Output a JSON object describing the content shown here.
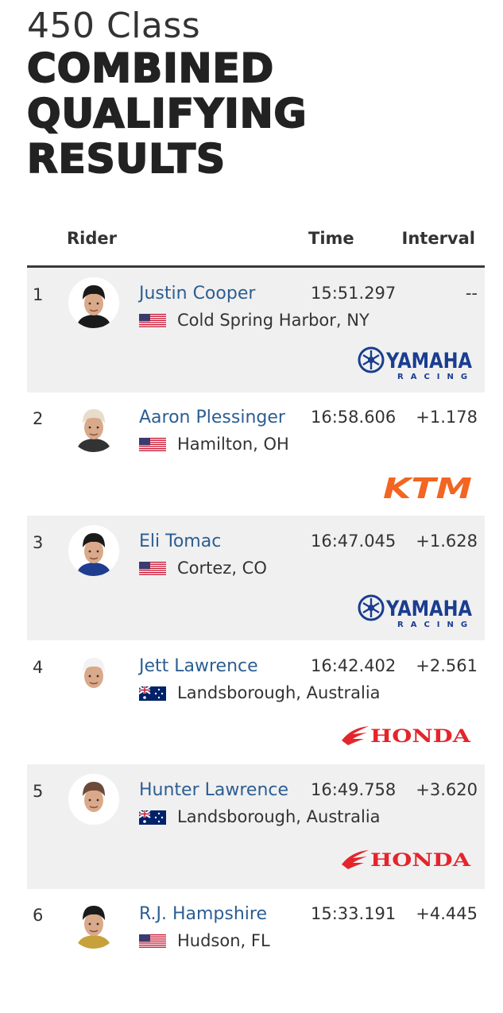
{
  "heading": {
    "class_label": "450 Class",
    "title_lines": [
      "COMBINED",
      "QUALIFYING",
      "RESULTS"
    ]
  },
  "table": {
    "columns": {
      "rider": "Rider",
      "time": "Time",
      "interval": "Interval"
    },
    "rows": [
      {
        "pos": "1",
        "name": "Justin Cooper",
        "location": "Cold Spring Harbor, NY",
        "flag": "usa-flag",
        "time": "15:51.297",
        "interval": "--",
        "brand": "yamaha",
        "helmet": "#1a1a1a",
        "shirt": "#1a1a1a"
      },
      {
        "pos": "2",
        "name": "Aaron Plessinger",
        "location": "Hamilton, OH",
        "flag": "usa-flag",
        "time": "16:58.606",
        "interval": "+1.178",
        "brand": "ktm",
        "helmet": "#e8dccb",
        "shirt": "#333333"
      },
      {
        "pos": "3",
        "name": "Eli Tomac",
        "location": "Cortez, CO",
        "flag": "usa-flag",
        "time": "16:47.045",
        "interval": "+1.628",
        "brand": "yamaha",
        "helmet": "#1a1a1a",
        "shirt": "#1f3d8f"
      },
      {
        "pos": "4",
        "name": "Jett Lawrence",
        "location": "Landsborough, Australia",
        "flag": "australia-flag",
        "time": "16:42.402",
        "interval": "+2.561",
        "brand": "honda",
        "helmet": "#f2f2f2",
        "shirt": "#ffffff"
      },
      {
        "pos": "5",
        "name": "Hunter Lawrence",
        "location": "Landsborough, Australia",
        "flag": "australia-flag",
        "time": "16:49.758",
        "interval": "+3.620",
        "brand": "honda",
        "helmet": "#6b4a3a",
        "shirt": "#ffffff"
      },
      {
        "pos": "6",
        "name": "R.J. Hampshire",
        "location": "Hudson, FL",
        "flag": "usa-flag",
        "time": "15:33.191",
        "interval": "+4.445",
        "brand": "",
        "helmet": "#1a1a1a",
        "shirt": "#c7a23a"
      }
    ]
  },
  "brands": {
    "yamaha": {
      "name": "YAMAHA",
      "sub": "RACING",
      "color": "#1a3d8f"
    },
    "ktm": {
      "name": "KTM",
      "color": "#f26522"
    },
    "honda": {
      "name": "HONDA",
      "color": "#e4252b"
    }
  }
}
